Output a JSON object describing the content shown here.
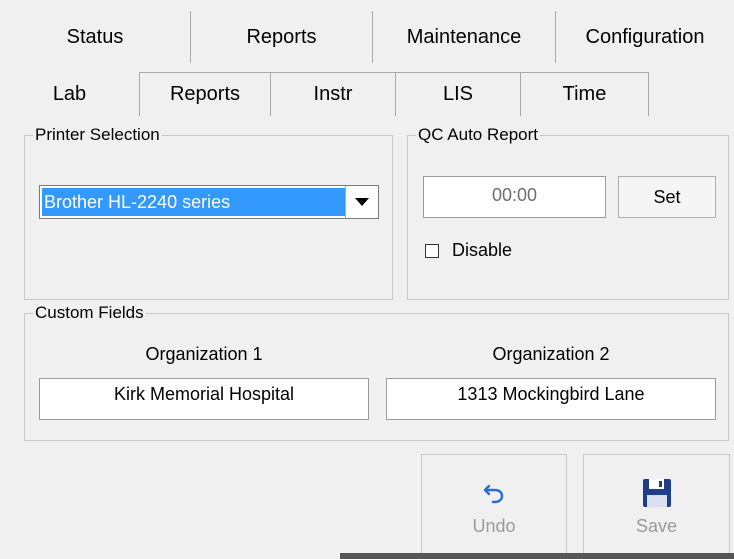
{
  "top_tabs": [
    "Status",
    "Reports",
    "Maintenance",
    "Configuration"
  ],
  "sub_tabs": [
    "Lab",
    "Reports",
    "Instr",
    "LIS",
    "Time"
  ],
  "printer": {
    "title": "Printer Selection",
    "selected": "Brother HL-2240 series"
  },
  "qc": {
    "title": "QC Auto Report",
    "time_value": "00:00",
    "set_label": "Set",
    "disable_label": "Disable"
  },
  "custom": {
    "title": "Custom Fields",
    "org1_label": "Organization 1",
    "org1_value": "Kirk Memorial Hospital",
    "org2_label": "Organization 2",
    "org2_value": "1313 Mockingbird Lane"
  },
  "actions": {
    "undo_label": "Undo",
    "save_label": "Save",
    "undo_icon": "undo-arrow-icon",
    "save_icon": "floppy-disk-icon"
  },
  "colors": {
    "selection": "#3399ff",
    "undo_icon": "#2b6cd6",
    "save_icon": "#1f3e8a"
  }
}
